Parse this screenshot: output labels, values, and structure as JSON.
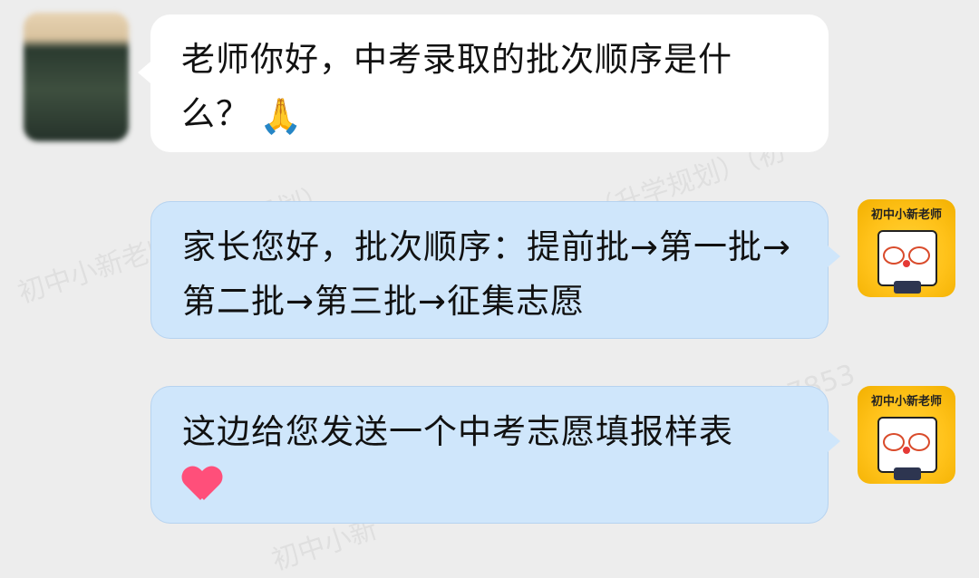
{
  "watermarks": [
    "初中小新老师（升学规划）",
    "（升学规划）（初",
    "方7853",
    "初中小新"
  ],
  "messages": [
    {
      "side": "left",
      "text": "老师你好，中考录取的批次顺序是什么？",
      "emoji": "hands-pressed-icon"
    },
    {
      "side": "right",
      "text": "家长您好，批次顺序：提前批→第一批→第二批→第三批→征集志愿"
    },
    {
      "side": "right",
      "text": "这边给您发送一个中考志愿填报样表",
      "emoji": "heart-icon"
    }
  ],
  "teacher_avatar": {
    "badge": "初中小新老师"
  },
  "colors": {
    "background": "#ededed",
    "left_bubble": "#ffffff",
    "right_bubble": "#cfe6fb",
    "avatar_yellow": "#ffc21a",
    "heart": "#ff4f7a"
  }
}
